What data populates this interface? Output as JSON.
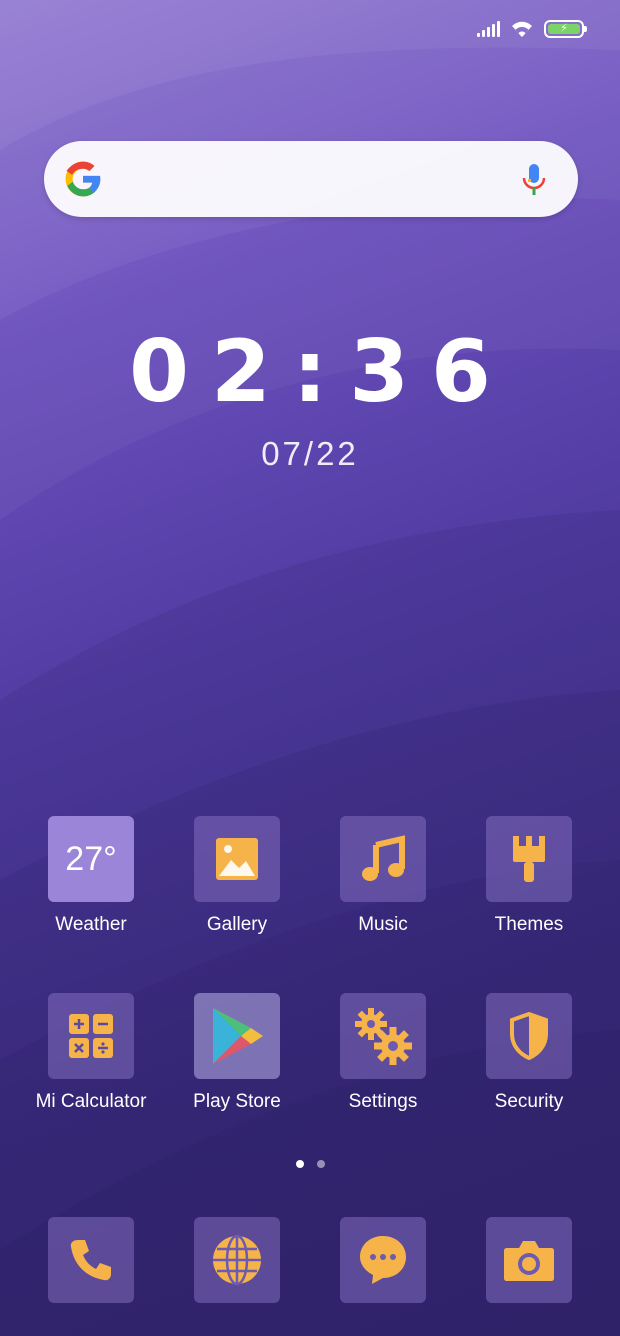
{
  "status_bar": {
    "signal_icon": "cellular-signal-icon",
    "wifi_icon": "wifi-icon",
    "battery_icon": "battery-charging-icon",
    "battery_color": "#7cd36a"
  },
  "search": {
    "logo_icon": "google-logo-icon",
    "mic_icon": "microphone-icon"
  },
  "clock": {
    "time": "02:36",
    "date": "07/22"
  },
  "apps": [
    {
      "label": "Weather",
      "icon": "weather-icon",
      "tile_text": "27°"
    },
    {
      "label": "Gallery",
      "icon": "gallery-icon"
    },
    {
      "label": "Music",
      "icon": "music-note-icon"
    },
    {
      "label": "Themes",
      "icon": "paintbrush-icon"
    },
    {
      "label": "Mi Calculator",
      "icon": "calculator-icon"
    },
    {
      "label": "Play Store",
      "icon": "play-store-icon"
    },
    {
      "label": "Settings",
      "icon": "gears-icon"
    },
    {
      "label": "Security",
      "icon": "shield-icon"
    }
  ],
  "page_indicator": {
    "pages": 2,
    "current": 1
  },
  "dock": [
    {
      "icon": "phone-icon"
    },
    {
      "icon": "browser-globe-icon"
    },
    {
      "icon": "messages-icon"
    },
    {
      "icon": "camera-icon"
    }
  ],
  "colors": {
    "icon_accent": "#f6b34a",
    "tile_bg": "rgba(130,110,190,0.55)"
  }
}
